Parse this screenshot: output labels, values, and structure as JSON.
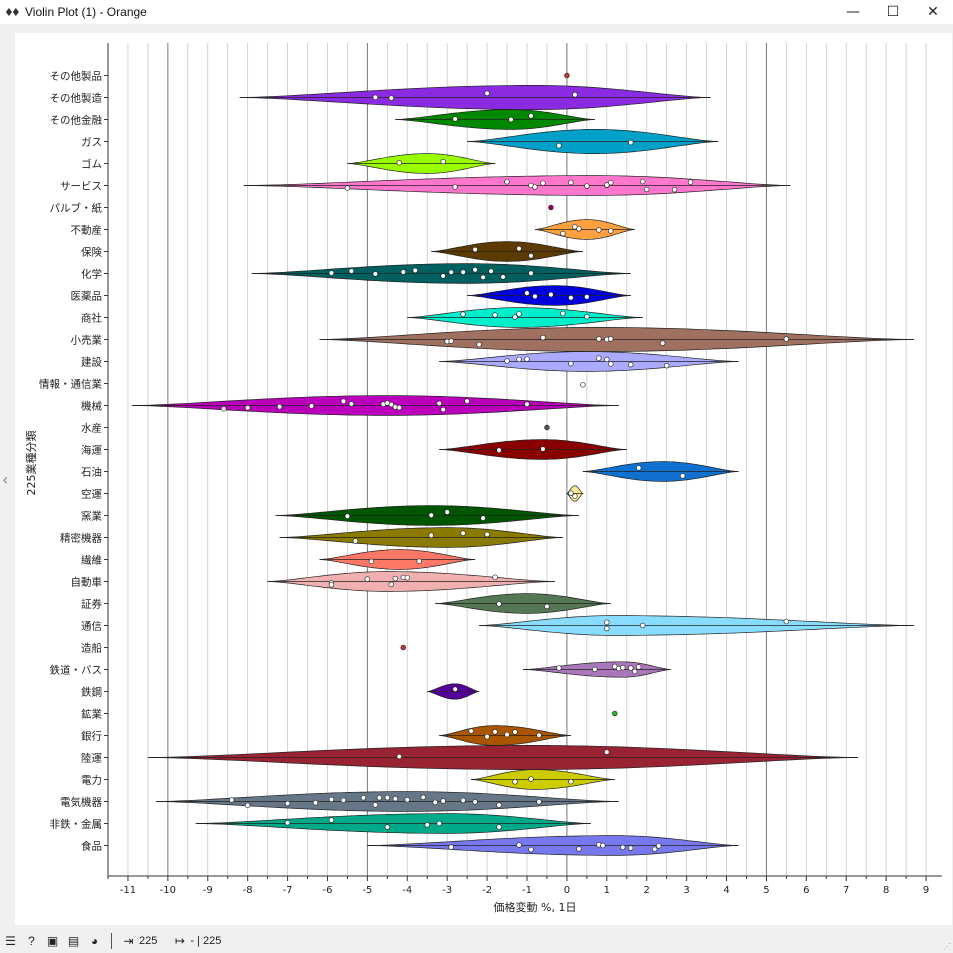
{
  "window": {
    "title": "Violin Plot (1) - Orange",
    "icon": "violin-icon"
  },
  "window_controls": {
    "minimize": "—",
    "maximize": "☐",
    "close": "✕"
  },
  "statusbar": {
    "input_count": "225",
    "output_text": "- | 225"
  },
  "chart_data": {
    "type": "violin",
    "xlabel": "価格変動 %, 1日",
    "ylabel": "225業種分類",
    "xlim": [
      -11.5,
      9.4
    ],
    "xticks": [
      -11,
      -10,
      -9,
      -8,
      -7,
      -6,
      -5,
      -4,
      -3,
      -2,
      -1,
      0,
      1,
      2,
      3,
      4,
      5,
      6,
      7,
      8,
      9
    ],
    "grid": true,
    "legend": "none",
    "categories": [
      {
        "name": "その他製品",
        "color": "#c0392b",
        "min": 0.0,
        "max": 0.0,
        "width": 0,
        "peak": 0.0,
        "points": [
          0.0
        ]
      },
      {
        "name": "その他製造",
        "color": "#8a2be2",
        "min": -8.2,
        "max": 3.6,
        "width": 0.55,
        "peak": -0.8,
        "points": [
          -4.8,
          -4.4,
          -2.0,
          0.2
        ]
      },
      {
        "name": "その他金融",
        "color": "#008800",
        "min": -4.3,
        "max": 0.7,
        "width": 0.45,
        "peak": -1.4,
        "points": [
          -2.8,
          -1.4,
          -0.9
        ]
      },
      {
        "name": "ガス",
        "color": "#00a0c8",
        "min": -2.5,
        "max": 3.8,
        "width": 0.55,
        "peak": 0.7,
        "points": [
          -0.2,
          1.6
        ]
      },
      {
        "name": "ゴム",
        "color": "#99ff00",
        "min": -5.5,
        "max": -1.8,
        "width": 0.45,
        "peak": -3.5,
        "points": [
          -4.2,
          -3.1
        ]
      },
      {
        "name": "サービス",
        "color": "#ff77cc",
        "min": -8.1,
        "max": 5.6,
        "width": 0.45,
        "peak": 0.7,
        "points": [
          -5.5,
          -2.8,
          -1.5,
          -0.9,
          -0.6,
          -0.8,
          0.1,
          0.5,
          1.0,
          1.1,
          1.9,
          2.0,
          2.7,
          3.1,
          1.0
        ]
      },
      {
        "name": "パルブ・紙",
        "color": "#990066",
        "min": -0.4,
        "max": -0.4,
        "width": 0,
        "peak": -0.4,
        "points": [
          -0.4
        ]
      },
      {
        "name": "不動産",
        "color": "#ffa040",
        "min": -0.8,
        "max": 1.7,
        "width": 0.45,
        "peak": 0.5,
        "points": [
          -0.1,
          0.2,
          0.3,
          0.8,
          1.1
        ]
      },
      {
        "name": "保険",
        "color": "#5c3a00",
        "min": -3.4,
        "max": 0.4,
        "width": 0.45,
        "peak": -1.5,
        "points": [
          -2.3,
          -1.2,
          -0.9
        ]
      },
      {
        "name": "化学",
        "color": "#005f5f",
        "min": -7.9,
        "max": 1.6,
        "width": 0.45,
        "peak": -2.5,
        "points": [
          -5.9,
          -5.4,
          -4.8,
          -4.1,
          -3.8,
          -3.1,
          -2.9,
          -2.6,
          -2.3,
          -2.1,
          -1.9,
          -1.6,
          -0.9
        ]
      },
      {
        "name": "医薬品",
        "color": "#0000dd",
        "min": -2.5,
        "max": 1.6,
        "width": 0.45,
        "peak": -0.3,
        "points": [
          -1.0,
          -0.8,
          -0.4,
          0.1,
          0.5
        ]
      },
      {
        "name": "商社",
        "color": "#00eecc",
        "min": -4.0,
        "max": 1.9,
        "width": 0.45,
        "peak": -1.2,
        "points": [
          -2.6,
          -1.8,
          -1.3,
          -1.2,
          -0.1,
          0.5
        ]
      },
      {
        "name": "小売業",
        "color": "#a07060",
        "min": -6.2,
        "max": 8.7,
        "width": 0.55,
        "peak": 0.7,
        "points": [
          -3.0,
          -2.9,
          -2.2,
          -0.6,
          0.8,
          1.0,
          1.1,
          2.4,
          5.5
        ]
      },
      {
        "name": "建設",
        "color": "#aaaaff",
        "min": -3.2,
        "max": 4.3,
        "width": 0.45,
        "peak": 0.5,
        "points": [
          -1.5,
          -1.2,
          -1.0,
          0.1,
          0.8,
          1.0,
          1.1,
          1.6,
          2.5
        ]
      },
      {
        "name": "情報・通信業",
        "color": "#aaaa00",
        "min": 0.4,
        "max": 0.4,
        "width": 0.15,
        "peak": 0.4,
        "points": [
          0.4
        ]
      },
      {
        "name": "機械",
        "color": "#bb00bb",
        "min": -10.9,
        "max": 1.3,
        "width": 0.45,
        "peak": -4.5,
        "points": [
          -8.6,
          -8.0,
          -7.2,
          -6.4,
          -5.6,
          -5.4,
          -4.6,
          -4.5,
          -4.4,
          -4.3,
          -4.2,
          -3.2,
          -3.1,
          -2.5,
          -1.0
        ]
      },
      {
        "name": "水産",
        "color": "#555555",
        "min": -0.5,
        "max": -0.5,
        "width": 0,
        "peak": -0.5,
        "points": [
          -0.5
        ]
      },
      {
        "name": "海運",
        "color": "#880000",
        "min": -3.2,
        "max": 1.5,
        "width": 0.45,
        "peak": -0.6,
        "points": [
          -1.7,
          -0.6
        ]
      },
      {
        "name": "石油",
        "color": "#1070d0",
        "min": 0.4,
        "max": 4.3,
        "width": 0.45,
        "peak": 2.4,
        "points": [
          1.8,
          2.9
        ]
      },
      {
        "name": "空運",
        "color": "#ffee99",
        "min": 0.0,
        "max": 0.4,
        "width": 0.35,
        "peak": 0.2,
        "points": [
          0.1,
          0.2
        ]
      },
      {
        "name": "窯業",
        "color": "#005500",
        "min": -7.3,
        "max": 0.3,
        "width": 0.45,
        "peak": -3.4,
        "points": [
          -5.5,
          -3.4,
          -3.0,
          -2.1
        ]
      },
      {
        "name": "精密機器",
        "color": "#8a7a00",
        "min": -7.2,
        "max": -0.1,
        "width": 0.45,
        "peak": -3.0,
        "points": [
          -5.3,
          -3.4,
          -2.6,
          -2.0
        ]
      },
      {
        "name": "繊維",
        "color": "#ff7766",
        "min": -6.2,
        "max": -2.3,
        "width": 0.45,
        "peak": -4.2,
        "points": [
          -4.9,
          -3.7
        ]
      },
      {
        "name": "自動車",
        "color": "#f0b0b0",
        "min": -7.5,
        "max": -0.3,
        "width": 0.45,
        "peak": -4.5,
        "points": [
          -5.9,
          -5.9,
          -5.0,
          -4.4,
          -4.3,
          -4.1,
          -4.0,
          -1.8
        ]
      },
      {
        "name": "証券",
        "color": "#557755",
        "min": -3.3,
        "max": 1.1,
        "width": 0.45,
        "peak": -1.0,
        "points": [
          -1.7,
          -0.5
        ]
      },
      {
        "name": "通信",
        "color": "#88ddff",
        "min": -2.2,
        "max": 8.7,
        "width": 0.45,
        "peak": 1.2,
        "points": [
          1.0,
          1.0,
          1.9,
          5.5
        ]
      },
      {
        "name": "造船",
        "color": "#cc3344",
        "min": -4.1,
        "max": -4.1,
        "width": 0,
        "peak": -4.1,
        "points": [
          -4.1
        ]
      },
      {
        "name": "鉄道・バス",
        "color": "#aa77bb",
        "min": -1.1,
        "max": 2.6,
        "width": 0.35,
        "peak": 1.4,
        "points": [
          -0.2,
          0.7,
          1.2,
          1.3,
          1.4,
          1.6,
          1.7,
          1.8
        ]
      },
      {
        "name": "鉄鋼",
        "color": "#550099",
        "min": -3.5,
        "max": -2.2,
        "width": 0.35,
        "peak": -2.8,
        "points": [
          -2.8
        ]
      },
      {
        "name": "鉱業",
        "color": "#22bb22",
        "min": 1.2,
        "max": 1.2,
        "width": 0,
        "peak": 1.2,
        "points": [
          1.2
        ]
      },
      {
        "name": "銀行",
        "color": "#aa5500",
        "min": -3.2,
        "max": 0.1,
        "width": 0.45,
        "peak": -1.8,
        "points": [
          -2.4,
          -2.0,
          -1.8,
          -1.5,
          -1.3,
          -0.7
        ]
      },
      {
        "name": "陸運",
        "color": "#992233",
        "min": -10.5,
        "max": 7.3,
        "width": 0.55,
        "peak": -1.0,
        "points": [
          -4.2,
          1.0
        ]
      },
      {
        "name": "電力",
        "color": "#cccc00",
        "min": -2.4,
        "max": 1.2,
        "width": 0.45,
        "peak": -0.8,
        "points": [
          -1.3,
          -0.9,
          0.1
        ]
      },
      {
        "name": "電気機器",
        "color": "#667788",
        "min": -10.3,
        "max": 1.3,
        "width": 0.45,
        "peak": -4.0,
        "points": [
          -8.4,
          -8.0,
          -7.0,
          -6.3,
          -5.9,
          -5.6,
          -5.1,
          -4.8,
          -4.7,
          -4.5,
          -4.3,
          -4.0,
          -3.6,
          -3.3,
          -3.1,
          -2.6,
          -2.3,
          -1.7,
          -0.7
        ]
      },
      {
        "name": "非鉄・金属",
        "color": "#00aa88",
        "min": -9.3,
        "max": 0.6,
        "width": 0.45,
        "peak": -3.0,
        "points": [
          -7.0,
          -5.9,
          -4.5,
          -3.5,
          -3.2,
          -1.7
        ]
      },
      {
        "name": "食品",
        "color": "#7777ee",
        "min": -5.0,
        "max": 4.3,
        "width": 0.45,
        "peak": 1.2,
        "points": [
          -2.9,
          -1.2,
          -0.9,
          0.3,
          0.8,
          0.9,
          1.4,
          1.6,
          2.2,
          2.3
        ]
      }
    ]
  }
}
